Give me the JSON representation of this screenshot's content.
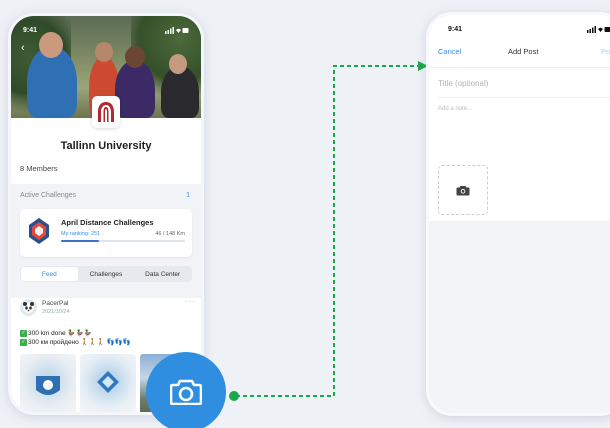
{
  "left_screen": {
    "status_time": "9:41",
    "back_icon": "chevron-left-icon",
    "org_name": "Tallinn University",
    "members": "8 Members",
    "active_challenges_label": "Active Challenges",
    "active_challenges_count": "1",
    "challenge": {
      "title": "April Distance Challenges",
      "ranking": "My ranking: 251",
      "distance": "46 / 148 Km",
      "progress": 0.31
    },
    "tabs": [
      "Feed",
      "Challenges",
      "Data Center"
    ],
    "active_tab": "Feed",
    "post": {
      "author": "PacerPal",
      "date": "2021/10/24",
      "more": "···",
      "line1": "300 km done 🦆🦆🦆",
      "line2": "300 км пройдено 🚶🚶🚶 👣👣👣"
    }
  },
  "camera_button": {
    "icon": "camera-icon"
  },
  "right_screen": {
    "status_time": "9:41",
    "nav": {
      "cancel": "Cancel",
      "title": "Add Post",
      "post": "Post"
    },
    "title_placeholder": "Title (optional)",
    "note_placeholder": "Add a note...",
    "photo_icon": "camera-icon"
  },
  "colors": {
    "accent": "#3a8ee6",
    "fab": "#2f8ee0",
    "connector": "#19a84a",
    "logo_red": "#b3282d"
  }
}
